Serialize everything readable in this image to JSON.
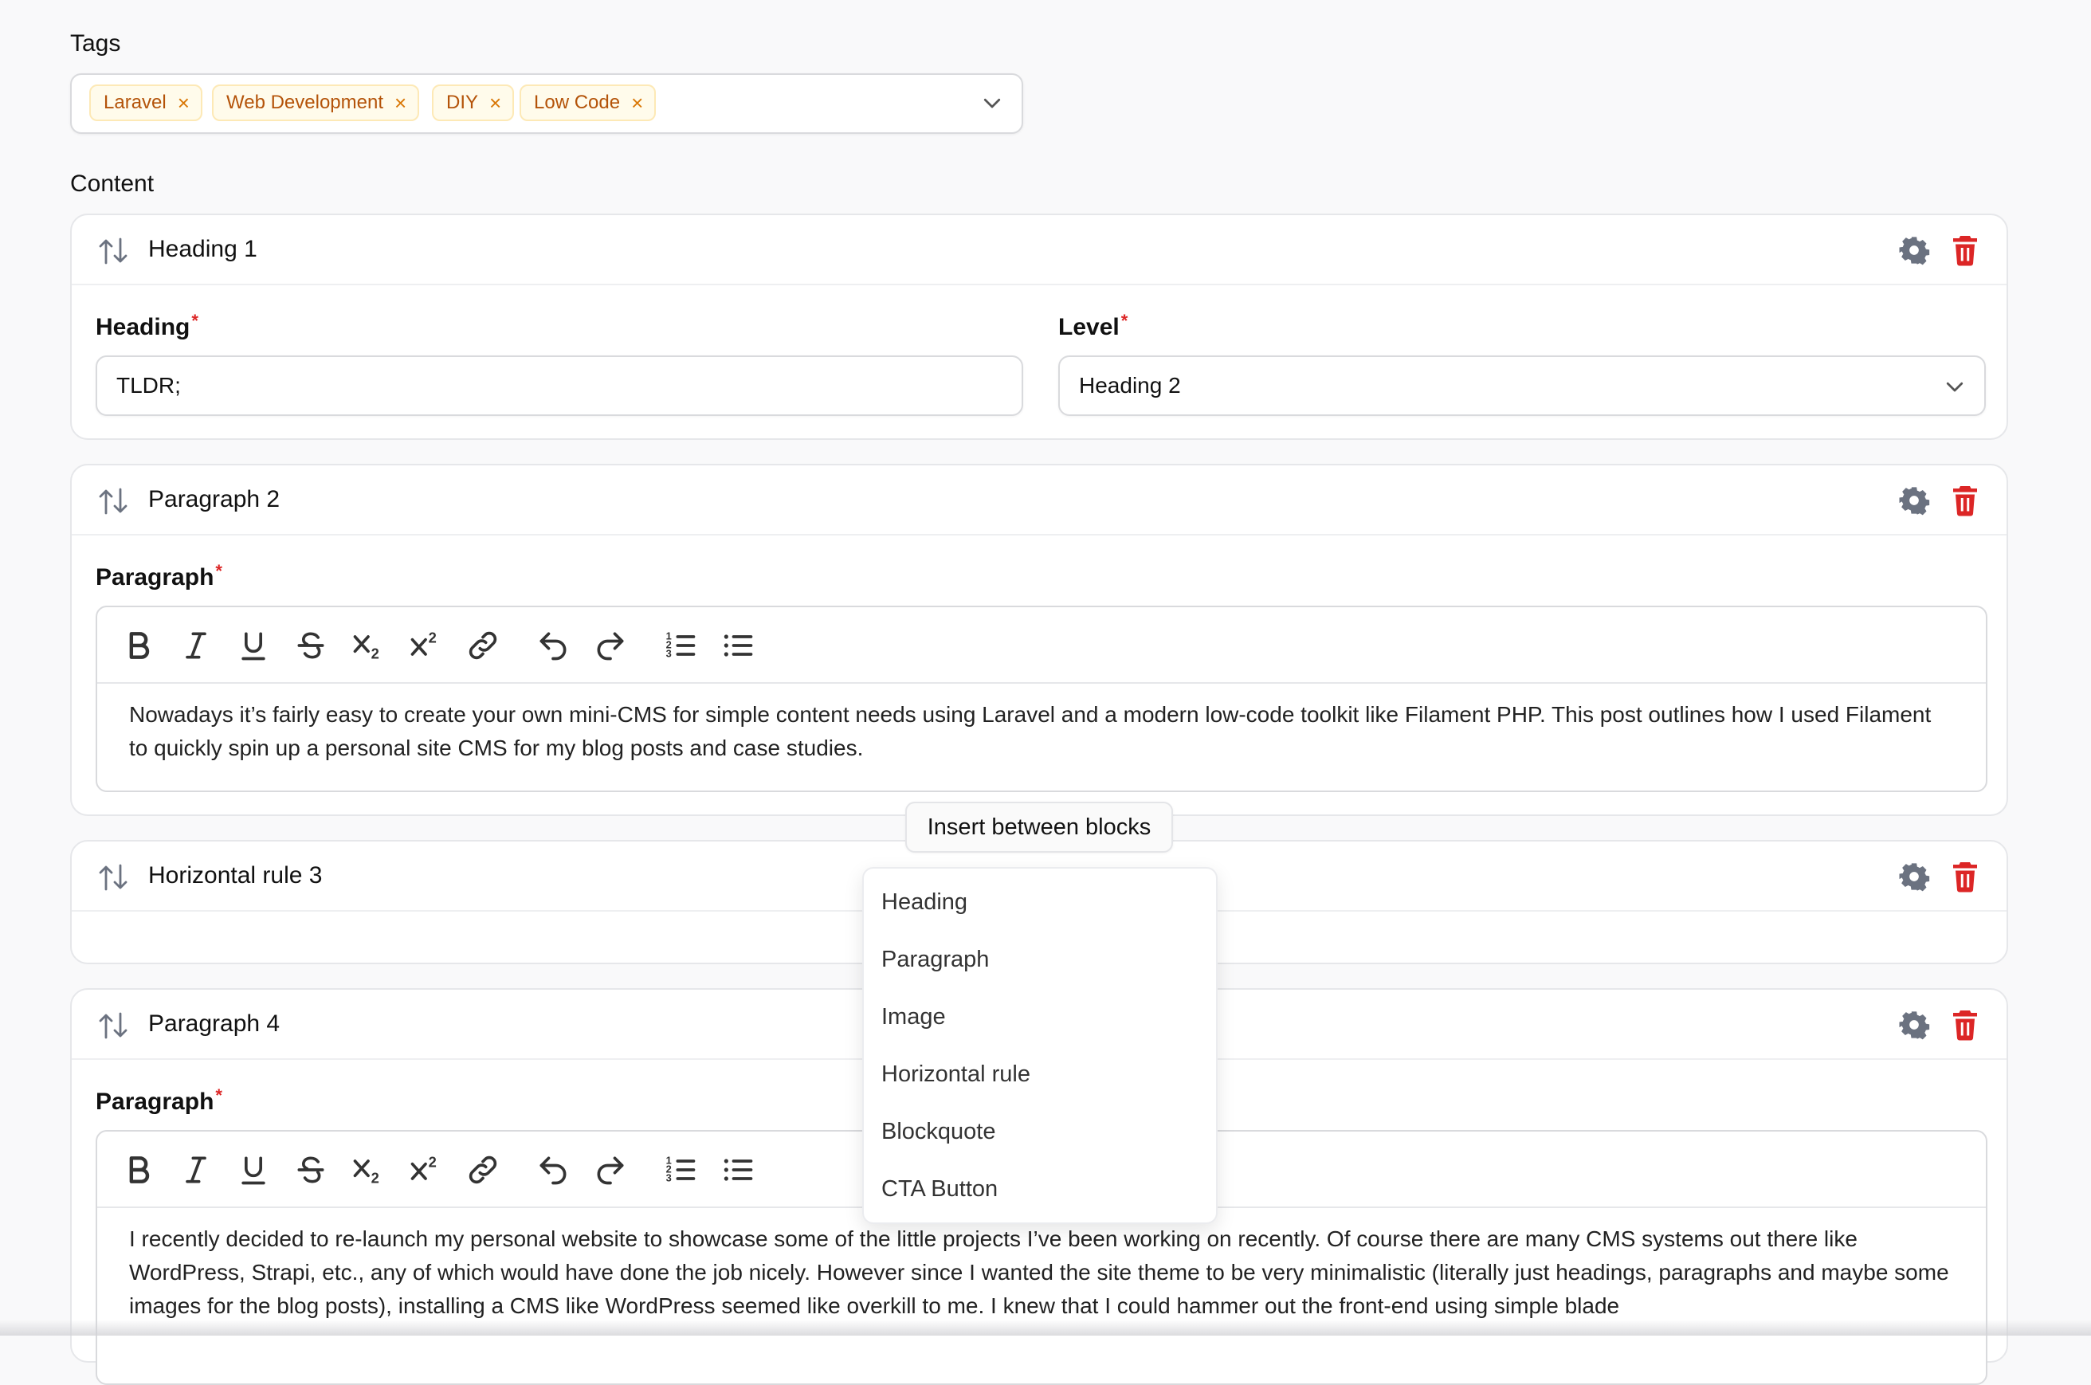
{
  "tags": {
    "label": "Tags",
    "items": [
      "Laravel",
      "Web Development",
      "DIY",
      "Low Code"
    ],
    "remove_glyph": "×"
  },
  "content": {
    "label": "Content",
    "required_mark": "*",
    "blocks": [
      {
        "title": "Heading 1",
        "heading_label": "Heading",
        "heading_value": "TLDR;",
        "level_label": "Level",
        "level_value": "Heading 2"
      },
      {
        "title": "Paragraph 2",
        "field_label": "Paragraph",
        "text": "Nowadays it’s fairly easy to create your own mini-CMS for simple content needs using Laravel and a modern low-code toolkit like Filament PHP. This post outlines how I used Filament to quickly spin up a personal site CMS for my blog posts and case studies."
      },
      {
        "title": "Horizontal rule 3"
      },
      {
        "title": "Paragraph 4",
        "field_label": "Paragraph",
        "text": "I recently decided to re-launch my personal website to showcase some of the little projects I’ve been working on recently. Of course there are many CMS systems out there like WordPress, Strapi, etc., any of which would have done the job nicely. However since I wanted the site theme to be very minimalistic (literally just headings, paragraphs and maybe some images for the blog posts), installing a CMS like WordPress seemed like overkill to me. I knew that I could hammer out the front-end using simple blade"
      }
    ]
  },
  "insert": {
    "button_label": "Insert between blocks",
    "options": [
      "Heading",
      "Paragraph",
      "Image",
      "Horizontal rule",
      "Blockquote",
      "CTA Button"
    ]
  },
  "colors": {
    "accent_tag_bg": "#fffbeb",
    "accent_tag_text": "#b45309",
    "danger": "#dc2626",
    "icon_gray": "#6b7280"
  },
  "toolbar_icons": [
    "bold-icon",
    "italic-icon",
    "underline-icon",
    "strikethrough-icon",
    "subscript-icon",
    "superscript-icon",
    "link-icon",
    "undo-icon",
    "redo-icon",
    "ordered-list-icon",
    "bullet-list-icon"
  ]
}
